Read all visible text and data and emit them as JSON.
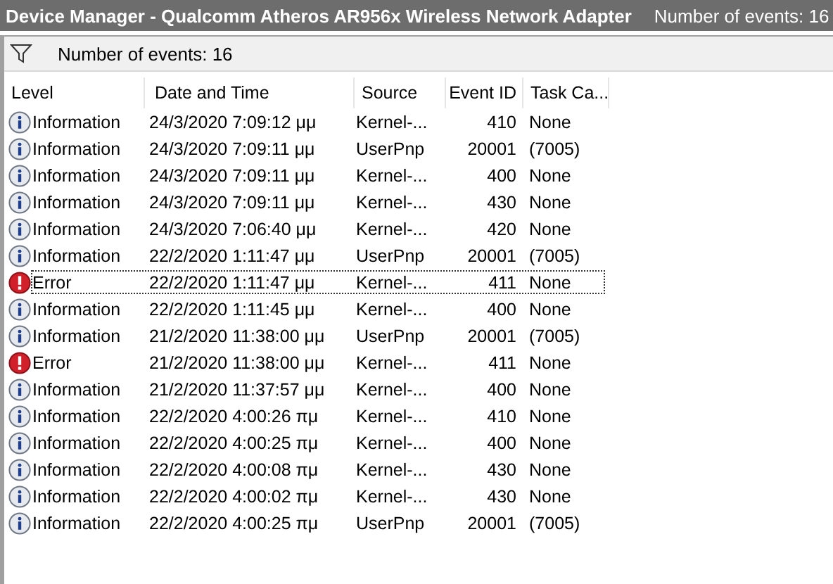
{
  "window": {
    "title": "Device Manager - Qualcomm Atheros AR956x Wireless Network Adapter",
    "event_count": "Number of events: 16"
  },
  "toolbar": {
    "event_count": "Number of events: 16"
  },
  "table": {
    "columns": [
      "Level",
      "Date and Time",
      "Source",
      "Event ID",
      "Task Ca..."
    ],
    "rows": [
      {
        "kind": "information",
        "level": "Information",
        "date": "24/3/2020 7:09:12 μμ",
        "source": "Kernel-...",
        "event_id": "410",
        "task": "None",
        "focused": false
      },
      {
        "kind": "information",
        "level": "Information",
        "date": "24/3/2020 7:09:11 μμ",
        "source": "UserPnp",
        "event_id": "20001",
        "task": "(7005)",
        "focused": false
      },
      {
        "kind": "information",
        "level": "Information",
        "date": "24/3/2020 7:09:11 μμ",
        "source": "Kernel-...",
        "event_id": "400",
        "task": "None",
        "focused": false
      },
      {
        "kind": "information",
        "level": "Information",
        "date": "24/3/2020 7:09:11 μμ",
        "source": "Kernel-...",
        "event_id": "430",
        "task": "None",
        "focused": false
      },
      {
        "kind": "information",
        "level": "Information",
        "date": "24/3/2020 7:06:40 μμ",
        "source": "Kernel-...",
        "event_id": "420",
        "task": "None",
        "focused": false
      },
      {
        "kind": "information",
        "level": "Information",
        "date": "22/2/2020 1:11:47 μμ",
        "source": "UserPnp",
        "event_id": "20001",
        "task": "(7005)",
        "focused": false
      },
      {
        "kind": "error",
        "level": "Error",
        "date": "22/2/2020 1:11:47 μμ",
        "source": "Kernel-...",
        "event_id": "411",
        "task": "None",
        "focused": true
      },
      {
        "kind": "information",
        "level": "Information",
        "date": "22/2/2020 1:11:45 μμ",
        "source": "Kernel-...",
        "event_id": "400",
        "task": "None",
        "focused": false
      },
      {
        "kind": "information",
        "level": "Information",
        "date": "21/2/2020 11:38:00 μμ",
        "source": "UserPnp",
        "event_id": "20001",
        "task": "(7005)",
        "focused": false
      },
      {
        "kind": "error",
        "level": "Error",
        "date": "21/2/2020 11:38:00 μμ",
        "source": "Kernel-...",
        "event_id": "411",
        "task": "None",
        "focused": false
      },
      {
        "kind": "information",
        "level": "Information",
        "date": "21/2/2020 11:37:57 μμ",
        "source": "Kernel-...",
        "event_id": "400",
        "task": "None",
        "focused": false
      },
      {
        "kind": "information",
        "level": "Information",
        "date": "22/2/2020 4:00:26 πμ",
        "source": "Kernel-...",
        "event_id": "410",
        "task": "None",
        "focused": false
      },
      {
        "kind": "information",
        "level": "Information",
        "date": "22/2/2020 4:00:25 πμ",
        "source": "Kernel-...",
        "event_id": "400",
        "task": "None",
        "focused": false
      },
      {
        "kind": "information",
        "level": "Information",
        "date": "22/2/2020 4:00:08 πμ",
        "source": "Kernel-...",
        "event_id": "430",
        "task": "None",
        "focused": false
      },
      {
        "kind": "information",
        "level": "Information",
        "date": "22/2/2020 4:00:02 πμ",
        "source": "Kernel-...",
        "event_id": "430",
        "task": "None",
        "focused": false
      },
      {
        "kind": "information",
        "level": "Information",
        "date": "22/2/2020 4:00:25 πμ",
        "source": "UserPnp",
        "event_id": "20001",
        "task": "(7005)",
        "focused": false
      }
    ]
  }
}
